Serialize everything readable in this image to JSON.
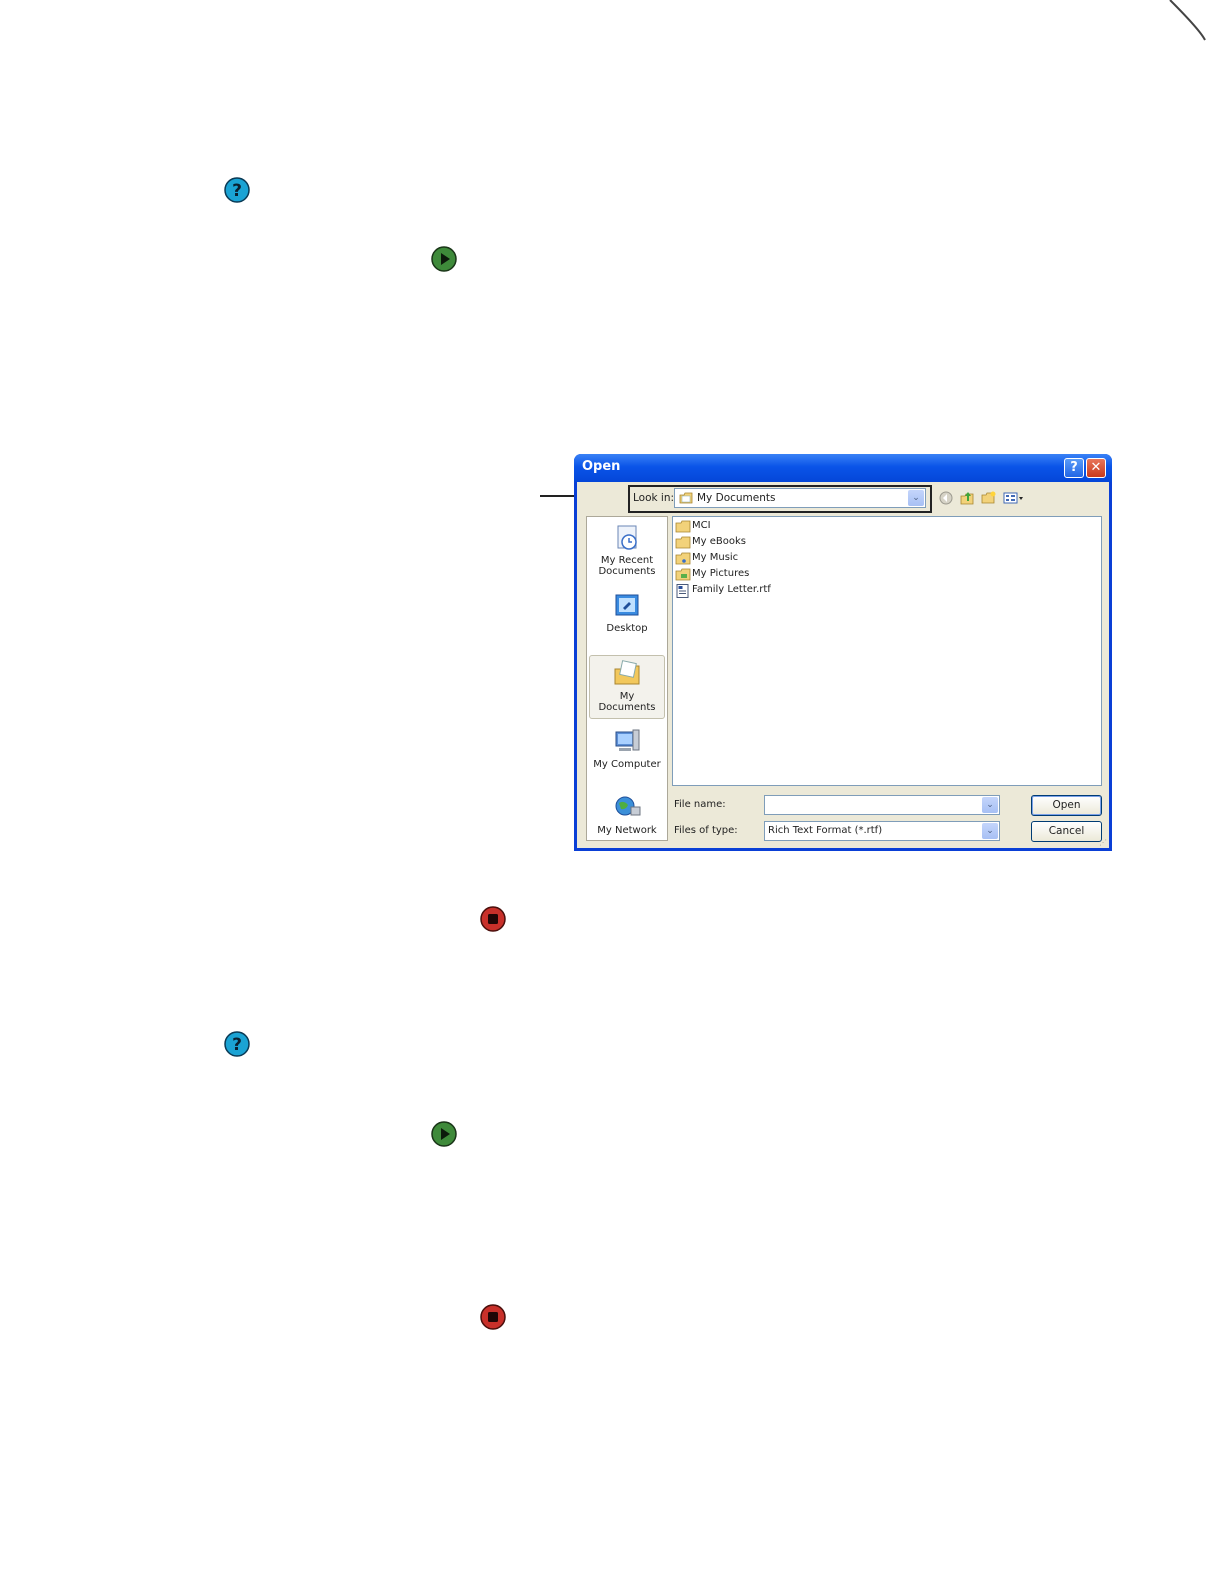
{
  "dialog": {
    "title": "Open",
    "help_glyph": "?",
    "close_glyph": "✕",
    "look_in_label": "Look in:",
    "look_in_value": "My Documents",
    "dropdown_glyph": "⌄",
    "places": [
      {
        "label": "My Recent Documents",
        "line1": "My Recent",
        "line2": "Documents",
        "icon": "recent-documents-icon"
      },
      {
        "label": "Desktop",
        "icon": "desktop-icon"
      },
      {
        "label": "My Documents",
        "icon": "my-documents-icon"
      },
      {
        "label": "My Computer",
        "icon": "my-computer-icon"
      },
      {
        "label": "My Network",
        "icon": "my-network-icon"
      }
    ],
    "files": [
      {
        "name": "MCI",
        "icon": "folder-icon"
      },
      {
        "name": "My eBooks",
        "icon": "folder-icon"
      },
      {
        "name": "My Music",
        "icon": "music-folder-icon"
      },
      {
        "name": "My Pictures",
        "icon": "pictures-folder-icon"
      },
      {
        "name": "Family Letter.rtf",
        "icon": "rtf-document-icon"
      }
    ],
    "file_name_label": "File name:",
    "file_name_value": "",
    "files_of_type_label": "Files of type:",
    "files_of_type_value": "Rich Text Format (*.rtf)",
    "open_button": "Open",
    "cancel_button": "Cancel"
  },
  "icons": {
    "help": "help-icon",
    "start": "play-icon",
    "stop": "stop-icon",
    "colors": {
      "help": "#1aa3d4",
      "start": "#3e8a3a",
      "stop": "#c8302a"
    }
  }
}
